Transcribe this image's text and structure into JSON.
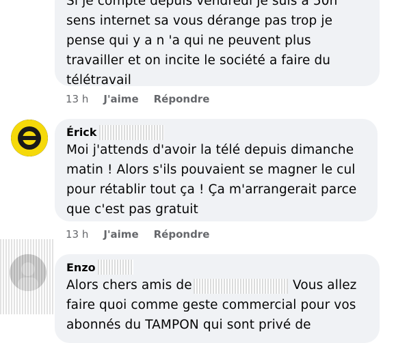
{
  "comments": [
    {
      "text": "Si je compte depuis vendredi je suis à 50h\nsens internet sa vous dérange pas trop je\npense qui y a n 'a qui ne peuvent plus\ntravailler et on incite le société a faire du\ntélétravail",
      "time": "13 h",
      "like": "J'aime",
      "reply": "Répondre"
    },
    {
      "author": "Érick",
      "text": "Moi j'attends d'avoir la télé depuis dimanche\nmatin ! Alors s'ils pouvaient se magner le cul\npour rétablir tout ça ! Ça m'arrangerait parce\nque c'est pas gratuit",
      "time": "13 h",
      "like": "J'aime",
      "reply": "Répondre"
    },
    {
      "author": "Enzo",
      "text_a": "Alors chers amis de",
      "text_b": "Vous allez",
      "text_rest": "faire quoi comme geste commercial pour vos\nabonnés du TAMPON qui sont privé de"
    }
  ],
  "colors": {
    "bubble": "#f0f2f5",
    "meta": "#65676b",
    "badge_yellow": "#f5d90a"
  }
}
